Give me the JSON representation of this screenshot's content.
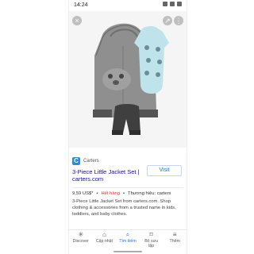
{
  "status": {
    "time": "14:24"
  },
  "photo": {
    "close_icon": "close-icon",
    "share_icon": "share-icon",
    "more_icon": "more-icon"
  },
  "result": {
    "source": "Carters",
    "title": "3-Piece Little Jacket Set | carters.com",
    "visit_label": "Visit",
    "price": "9,59 US$*",
    "stock": "Hết hàng",
    "brand": "Thương hiệu: carters",
    "description": "3-Piece Little Jacket Set from carters.com. Shop clothing & accessories from a trusted name in kids, toddlers, and baby clothes."
  },
  "bottom_nav": [
    {
      "label": "Discover",
      "icon": "asterisk-icon"
    },
    {
      "label": "Cập nhật",
      "icon": "inbox-icon"
    },
    {
      "label": "Tìm kiếm",
      "icon": "search-icon"
    },
    {
      "label": "Bộ sưu tập",
      "icon": "bookmark-icon"
    },
    {
      "label": "Thêm",
      "icon": "menu-icon"
    }
  ]
}
